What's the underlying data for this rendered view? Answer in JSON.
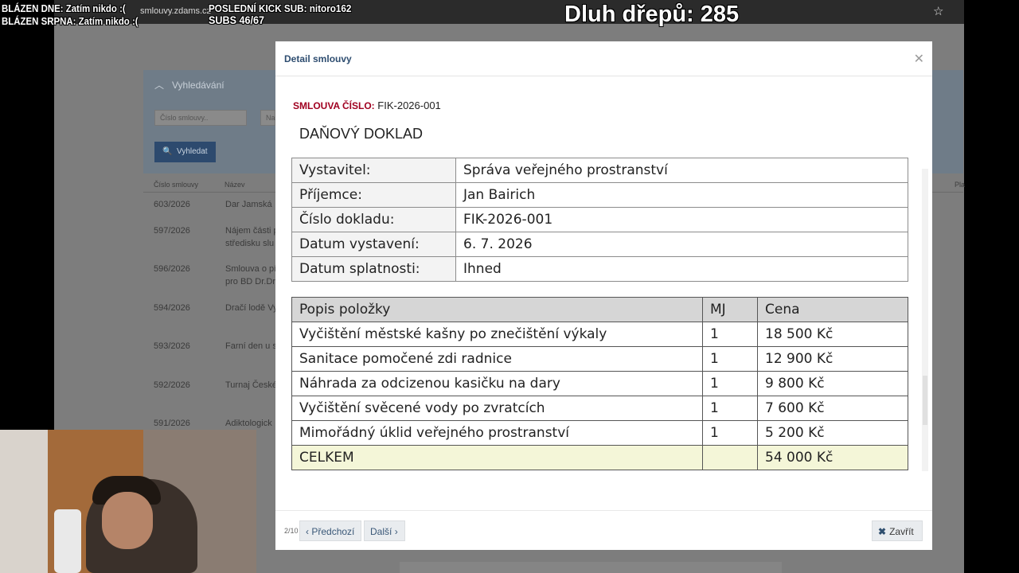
{
  "overlays": {
    "blazen_dne": "BLÁZEN DNE: Zatím nikdo :(",
    "blazen_srpna": "BLÁZEN SRPNA: Zatím nikdo :(",
    "kick_sub": "POSLEDNÍ KICK SUB: nitoro162",
    "subs": "SUBS 46/67",
    "dluh": "Dluh dřepů: 285"
  },
  "browser": {
    "url": "smlouvy.zdams.cz"
  },
  "background_page": {
    "search_title": "Vyhledávání",
    "contract_number_placeholder": "Číslo smlouvy..",
    "name_placeholder": "Na",
    "search_button": "Vyhledat",
    "col_number": "Číslo smlouvy",
    "col_name": "Název",
    "col_right": "Pla",
    "rows": [
      {
        "number": "603/2026",
        "name": "Dar Jamská"
      },
      {
        "number": "597/2026",
        "name": "Nájem části p",
        "name2": "středisku slu"
      },
      {
        "number": "596/2026",
        "name": "Smlouva o pí",
        "name2": "pro BD Dr.Dro"
      },
      {
        "number": "594/2026",
        "name": "Dračí lodě Vy"
      },
      {
        "number": "593/2026",
        "name": "Farní den u s"
      },
      {
        "number": "592/2026",
        "name": "Turnaj České"
      },
      {
        "number": "591/2026",
        "name": "Adiktologick"
      }
    ]
  },
  "modal": {
    "title": "Detail smlouvy",
    "contract_label": "SMLOUVA ČÍSLO:",
    "contract_number": "FIK-2026-001",
    "doc_title": "DAŇOVÝ DOKLAD",
    "info": [
      {
        "label": "Vystavitel:",
        "value": "Správa veřejného prostranství"
      },
      {
        "label": "Příjemce:",
        "value": "Jan Bairich"
      },
      {
        "label": "Číslo dokladu:",
        "value": "FIK-2026-001"
      },
      {
        "label": "Datum vystavení:",
        "value": "6. 7. 2026"
      },
      {
        "label": "Datum splatnosti:",
        "value": "Ihned"
      }
    ],
    "items_header": {
      "desc": "Popis položky",
      "mj": "MJ",
      "price": "Cena"
    },
    "items": [
      {
        "desc": "Vyčištění městské kašny po znečištění výkaly",
        "mj": "1",
        "price": "18 500 Kč"
      },
      {
        "desc": "Sanitace pomočené zdi radnice",
        "mj": "1",
        "price": "12 900 Kč"
      },
      {
        "desc": "Náhrada za odcizenou kasičku na dary",
        "mj": "1",
        "price": "9 800 Kč"
      },
      {
        "desc": "Vyčištění svěcené vody po zvratcích",
        "mj": "1",
        "price": "7 600 Kč"
      },
      {
        "desc": "Mimořádný úklid veřejného prostranství",
        "mj": "1",
        "price": "5 200 Kč"
      }
    ],
    "total": {
      "label": "CELKEM",
      "mj": "",
      "price": "54 000 Kč"
    },
    "footer": {
      "page_count": "2/10",
      "prev": "Předchozí",
      "next": "Další",
      "close": "Zavřít"
    }
  }
}
